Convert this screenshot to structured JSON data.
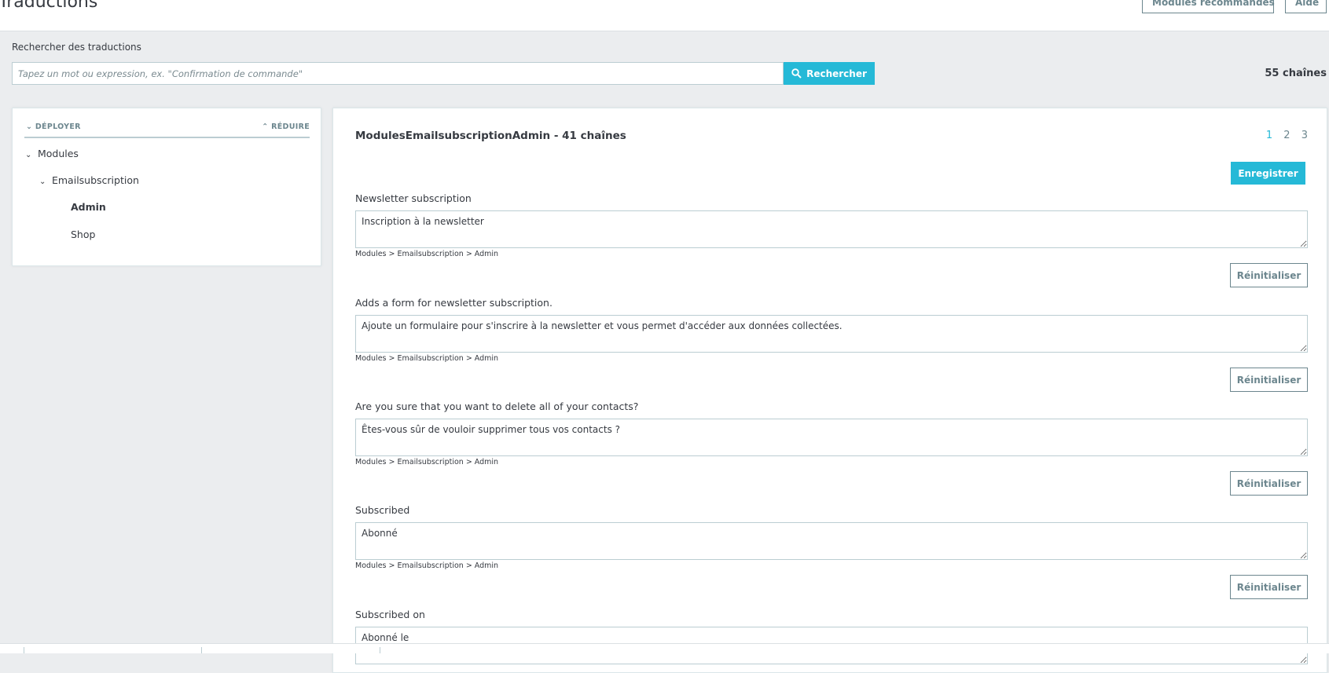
{
  "header": {
    "title": "Traductions",
    "buttons": {
      "recommended": "Modules recommandés",
      "help": "Aide"
    }
  },
  "search": {
    "label": "Rechercher des traductions",
    "placeholder": "Tapez un mot ou expression, ex. \"Confirmation de commande\"",
    "button": "Rechercher",
    "total": "55 chaînes"
  },
  "tree": {
    "expand": "DÉPLOYER",
    "collapse": "RÉDUIRE",
    "items": [
      "Modules",
      "Emailsubscription",
      "Admin",
      "Shop"
    ]
  },
  "main": {
    "title": "ModulesEmailsubscriptionAdmin - 41 chaînes",
    "pages": [
      "1",
      "2",
      "3"
    ],
    "active_page": "1",
    "save": "Enregistrer",
    "reset": "Réinitialiser",
    "entries": [
      {
        "source": "Newsletter subscription",
        "value": "Inscription à la newsletter",
        "path": "Modules > Emailsubscription > Admin"
      },
      {
        "source": "Adds a form for newsletter subscription.",
        "value": "Ajoute un formulaire pour s'inscrire à la newsletter et vous permet d'accéder aux données collectées.",
        "path": "Modules > Emailsubscription > Admin"
      },
      {
        "source": "Are you sure that you want to delete all of your contacts?",
        "value": "Êtes-vous sûr de vouloir supprimer tous vos contacts ?",
        "path": "Modules > Emailsubscription > Admin"
      },
      {
        "source": "Subscribed",
        "value": "Abonné",
        "path": "Modules > Emailsubscription > Admin"
      },
      {
        "source": "Subscribed on",
        "value": "Abonné le",
        "path": ""
      }
    ]
  },
  "colors": {
    "accent": "#25b9d7",
    "text": "#363a41",
    "muted": "#6c868e",
    "border": "#bbcdd2",
    "background": "#ebedef"
  }
}
